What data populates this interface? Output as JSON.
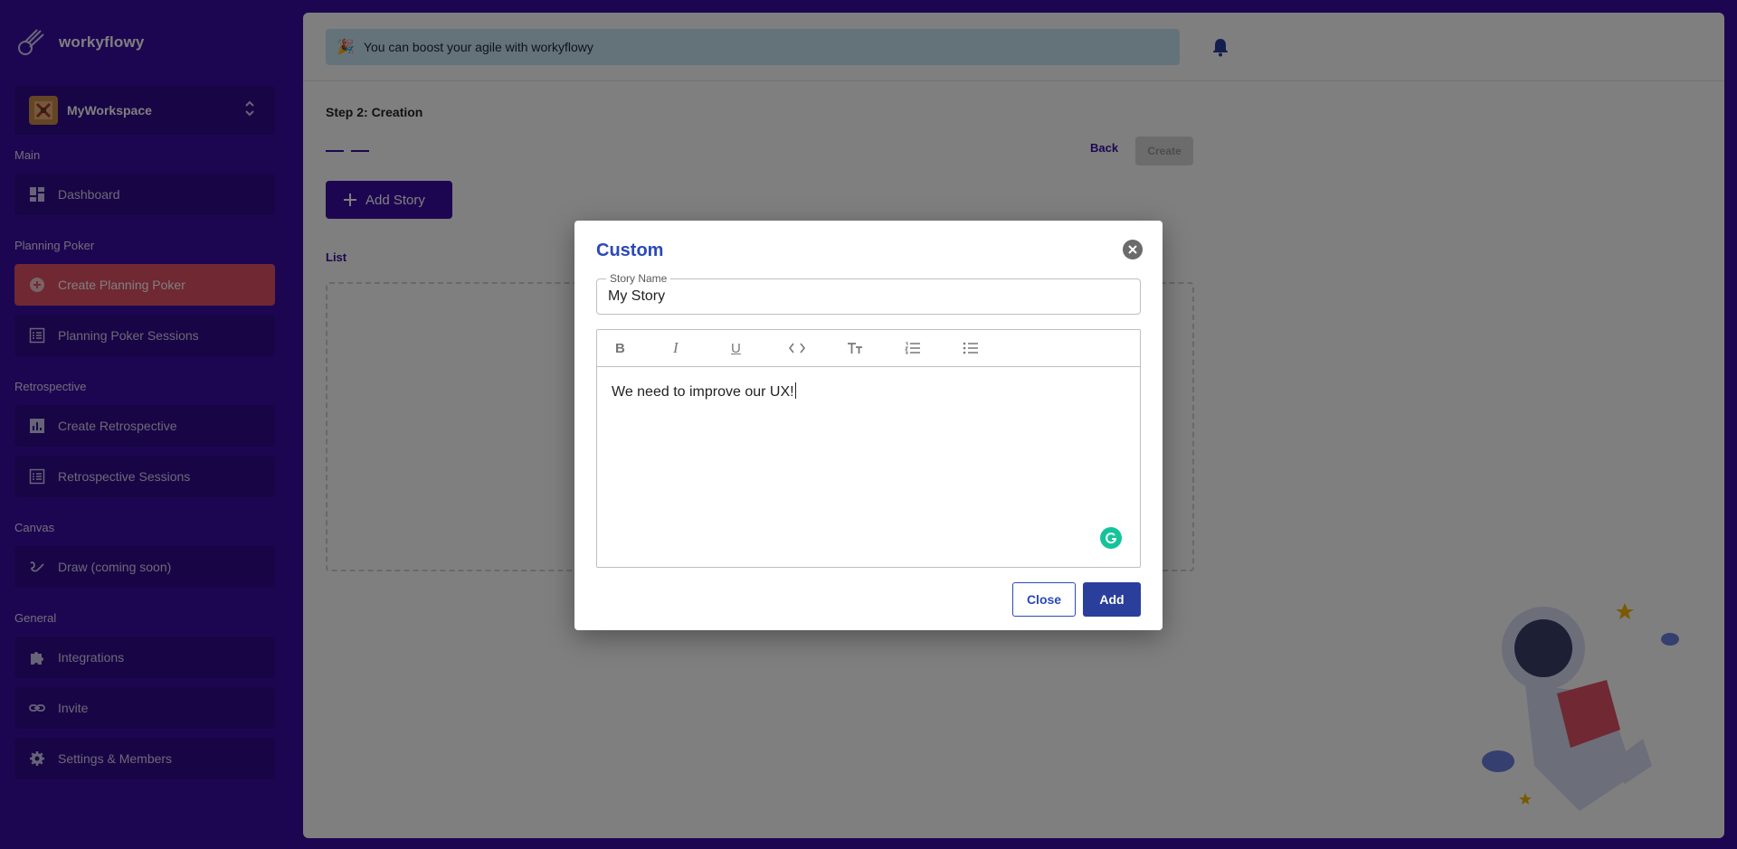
{
  "brand": {
    "name": "workyflowy"
  },
  "workspace": {
    "name": "MyWorkspace"
  },
  "sidebar": {
    "sections": {
      "main": "Main",
      "planning": "Planning Poker",
      "retro": "Retrospective",
      "canvas": "Canvas",
      "general": "General"
    },
    "items": {
      "dashboard": "Dashboard",
      "create_poker": "Create Planning Poker",
      "poker_sessions": "Planning Poker Sessions",
      "create_retro": "Create Retrospective",
      "retro_sessions": "Retrospective Sessions",
      "draw": "Draw (coming soon)",
      "integrations": "Integrations",
      "invite": "Invite",
      "settings": "Settings & Members"
    },
    "active_item": "create_poker"
  },
  "header": {
    "banner_text": "You can boost your agile with workyflowy",
    "banner_emoji": "🎉"
  },
  "page": {
    "step_title": "Step 2: Creation",
    "back_label": "Back",
    "create_label": "Create",
    "add_story_label": "Add Story",
    "list_title": "List"
  },
  "modal": {
    "title": "Custom",
    "story_name_label": "Story Name",
    "story_name_value": "My Story",
    "editor_text": "We need to improve our UX!",
    "close_label": "Close",
    "add_label": "Add",
    "toolbar": [
      "bold",
      "italic",
      "underline",
      "code",
      "heading",
      "ordered-list",
      "bullet-list"
    ]
  },
  "colors": {
    "sidebar_bg": "#3a0ca3",
    "active_item": "#e05066",
    "modal_title": "#2a49b8",
    "primary_button": "#2a3f9c",
    "banner_bg": "#c8e4f4"
  }
}
